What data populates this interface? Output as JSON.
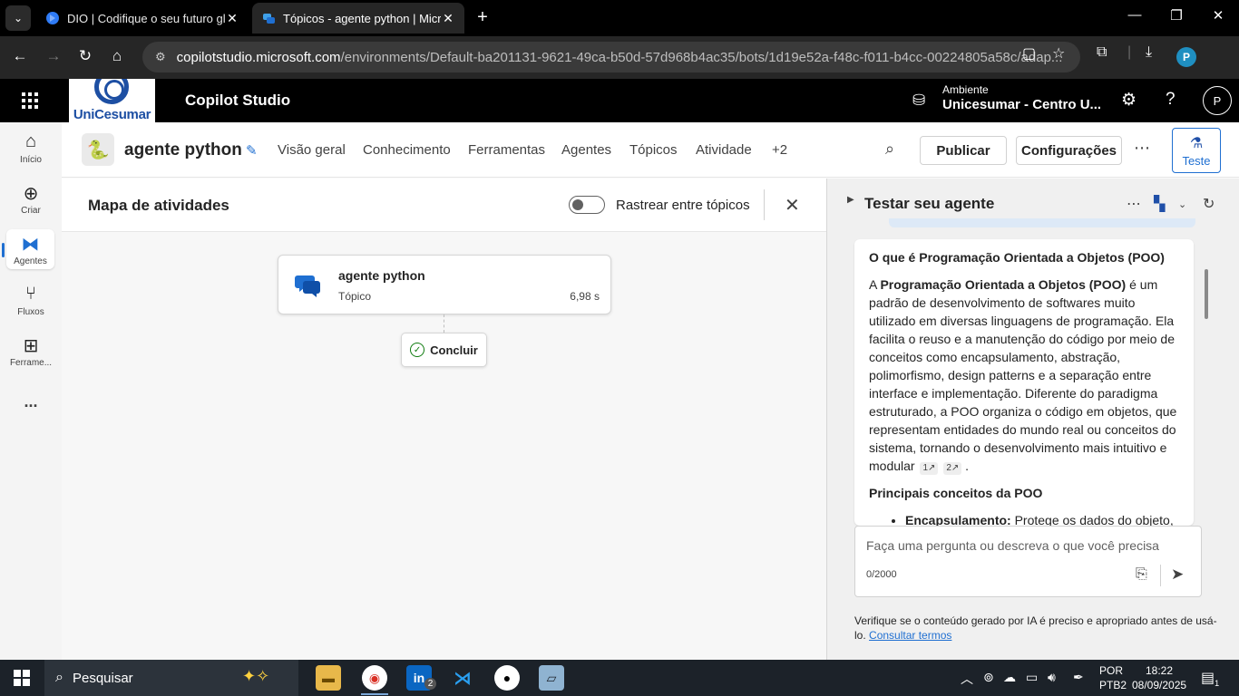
{
  "browser": {
    "tabs": [
      {
        "title": "DIO | Codifique o seu futuro gl",
        "favicon": "dio-icon",
        "active": false
      },
      {
        "title": "Tópicos - agente python | Micro",
        "favicon": "copilot-studio-icon",
        "active": true
      }
    ],
    "url_host": "copilotstudio.microsoft.com",
    "url_path": "/environments/Default-ba201131-9621-49ca-b50d-57d968b4ac35/bots/1d19e52a-f48c-f011-b4cc-00224805a58c/adap...",
    "profile_initial": "P"
  },
  "app_header": {
    "logo_text": "UniCesumar",
    "product_name": "Copilot Studio",
    "environment_label": "Ambiente",
    "environment_value": "Unicesumar - Centro U...",
    "user_initial": "P"
  },
  "rail": {
    "items": [
      {
        "label": "Início",
        "icon": "home-icon"
      },
      {
        "label": "Criar",
        "icon": "plus-circle-icon"
      },
      {
        "label": "Agentes",
        "icon": "agents-icon",
        "active": true
      },
      {
        "label": "Fluxos",
        "icon": "flows-icon"
      },
      {
        "label": "Ferrame...",
        "icon": "tools-icon"
      }
    ],
    "more": "..."
  },
  "agentbar": {
    "agent_name": "agente python",
    "tabs": [
      "Visão geral",
      "Conhecimento",
      "Ferramentas",
      "Agentes",
      "Tópicos",
      "Atividade",
      "+2"
    ],
    "publish_label": "Publicar",
    "settings_label": "Configurações",
    "test_label": "Teste"
  },
  "activity_map": {
    "title": "Mapa de atividades",
    "toggle_label": "Rastrear entre tópicos",
    "toggle_on": false,
    "node": {
      "name": "agente python",
      "type": "Tópico",
      "duration": "6,98 s"
    },
    "end_node": "Concluir"
  },
  "test_panel": {
    "title": "Testar seu agente",
    "message": {
      "heading": "O que é Programação Orientada a Objetos (POO)",
      "para_prefix": "A ",
      "para_bold": "Programação Orientada a Objetos (POO)",
      "para_rest": " é um padrão de desenvolvimento de softwares muito utilizado em diversas linguagens de programação. Ela facilita o reuso e a manutenção do código por meio de conceitos como encapsulamento, abstração, polimorfismo, design patterns e a separação entre interface e implementação. Diferente do paradigma estruturado, a POO organiza o código em objetos, que representam entidades do mundo real ou conceitos do sistema, tornando o desenvolvimento mais intuitivo e modular",
      "cite1": "1",
      "cite2": "2",
      "para_end": ".",
      "subheading": "Principais conceitos da POO",
      "bullet_bold": "Encapsulamento:",
      "bullet_text": " Protege os dados do objeto,"
    },
    "input_placeholder": "Faça uma pergunta ou descreva o que você precisa",
    "char_counter": "0/2000",
    "disclaimer": "Verifique se o conteúdo gerado por IA é preciso e apropriado antes de usá-lo.",
    "terms_link": "Consultar termos"
  },
  "taskbar": {
    "search_placeholder": "Pesquisar",
    "linkedin_badge": "2",
    "lang_line1": "POR",
    "lang_line2": "PTB2",
    "time": "18:22",
    "date": "08/09/2025",
    "notification_count": "1"
  },
  "colors": {
    "accent": "#1f6fd1",
    "header_bg": "#000000",
    "success": "#107c10"
  }
}
